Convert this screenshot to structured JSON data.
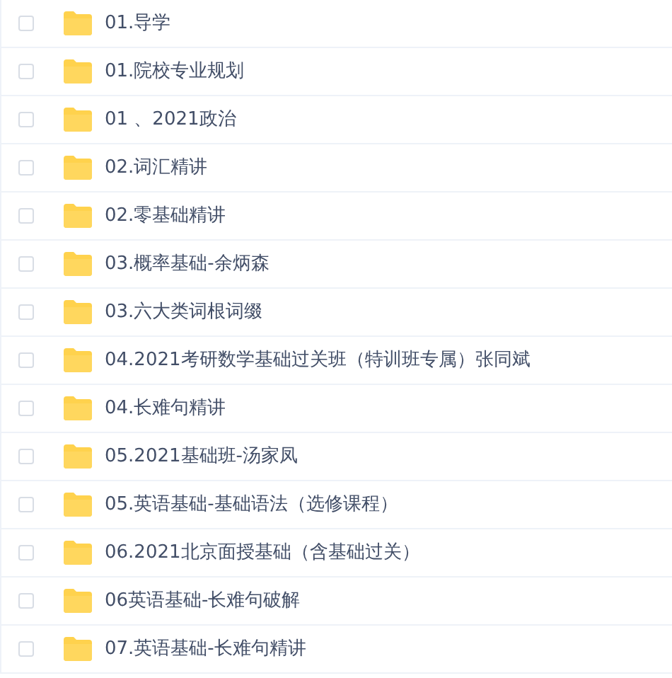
{
  "files": [
    {
      "name": "01.导学",
      "checked": false
    },
    {
      "name": "01.院校专业规划",
      "checked": false
    },
    {
      "name": "01 、2021政治",
      "checked": false
    },
    {
      "name": "02.词汇精讲",
      "checked": false
    },
    {
      "name": "02.零基础精讲",
      "checked": false
    },
    {
      "name": "03.概率基础-余炳森",
      "checked": false
    },
    {
      "name": "03.六大类词根词缀",
      "checked": false
    },
    {
      "name": "04.2021考研数学基础过关班（特训班专属）张同斌",
      "checked": false
    },
    {
      "name": "04.长难句精讲",
      "checked": false
    },
    {
      "name": "05.2021基础班-汤家凤",
      "checked": false
    },
    {
      "name": "05.英语基础-基础语法（选修课程）",
      "checked": false
    },
    {
      "name": "06.2021北京面授基础（含基础过关）",
      "checked": false
    },
    {
      "name": "06英语基础-长难句破解",
      "checked": false
    },
    {
      "name": "07.英语基础-长难句精讲",
      "checked": false
    }
  ]
}
